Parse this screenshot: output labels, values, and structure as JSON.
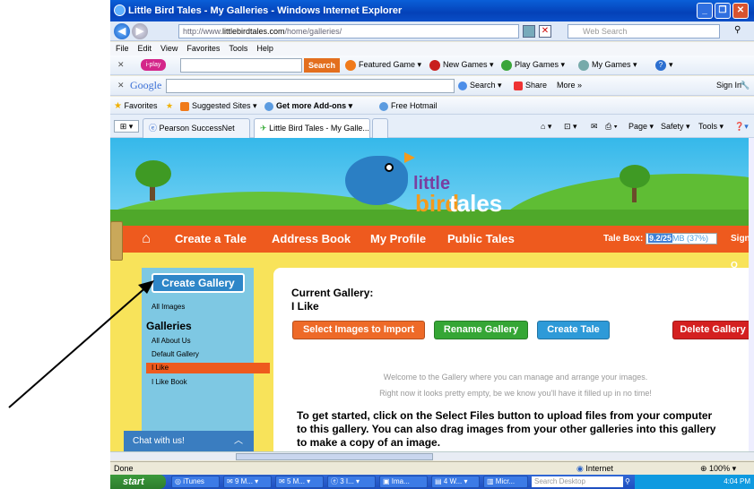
{
  "window": {
    "title": "Little Bird Tales - My Galleries - Windows Internet Explorer"
  },
  "address": {
    "prefix": "http://www.",
    "domain": "littlebirdtales.com",
    "path": "/home/galleries/",
    "web_search_placeholder": "Web Search"
  },
  "menu": [
    "File",
    "Edit",
    "View",
    "Favorites",
    "Tools",
    "Help"
  ],
  "toolbar1": {
    "search_btn": "Search",
    "featured": "Featured Game",
    "new_games": "New Games",
    "play_games": "Play Games",
    "my_games": "My Games"
  },
  "toolbar2": {
    "google": "Google",
    "search": "Search",
    "share": "Share",
    "more": "More »",
    "sign_in": "Sign In"
  },
  "favbar": {
    "favorites": "Favorites",
    "suggested": "Suggested Sites",
    "addons": "Get more Add-ons",
    "hotmail": "Free Hotmail"
  },
  "tabs": {
    "tab1": "Pearson SuccessNet",
    "tab2": "Little Bird Tales - My Galle...",
    "page": "Page",
    "safety": "Safety",
    "tools": "Tools"
  },
  "logo": {
    "little": "little",
    "bird": "bird",
    "tales": "tales"
  },
  "nav": {
    "create": "Create a Tale",
    "address": "Address Book",
    "profile": "My Profile",
    "public": "Public Tales",
    "talebox_label": "Tale Box:",
    "talebox_used": "9.2/25",
    "talebox_rest": "MB (37%)",
    "sign": "Sign O"
  },
  "sidebar": {
    "create_gallery": "Create Gallery",
    "all_images": "All Images",
    "galleries_heading": "Galleries",
    "items": [
      "All About Us",
      "Default Gallery",
      "I Like",
      "I Like Book"
    ],
    "chat": "Chat with us!"
  },
  "main": {
    "current_label": "Current Gallery:",
    "current_name": "I Like",
    "btn_import": "Select Images to Import",
    "btn_rename": "Rename Gallery",
    "btn_tale": "Create Tale",
    "btn_delete": "Delete Gallery",
    "welcome1": "Welcome to the Gallery where you can manage and arrange your images.",
    "welcome2": "Right now it looks pretty empty, be we know you'll have it filled up in no time!",
    "get_started": "To get started, click on the Select Files button to upload files from your computer to this gallery. You can also drag images from your other galleries into this gallery to make a copy of an image."
  },
  "status": {
    "left": "Done",
    "zone": "Internet",
    "zoom": "100%"
  },
  "taskbar": {
    "start": "start",
    "items": [
      "iTunes",
      "9 M...",
      "5 M...",
      "3 I...",
      "Ima...",
      "4 W...",
      "Micr..."
    ],
    "search": "Search Desktop",
    "clock": "4:04 PM"
  }
}
